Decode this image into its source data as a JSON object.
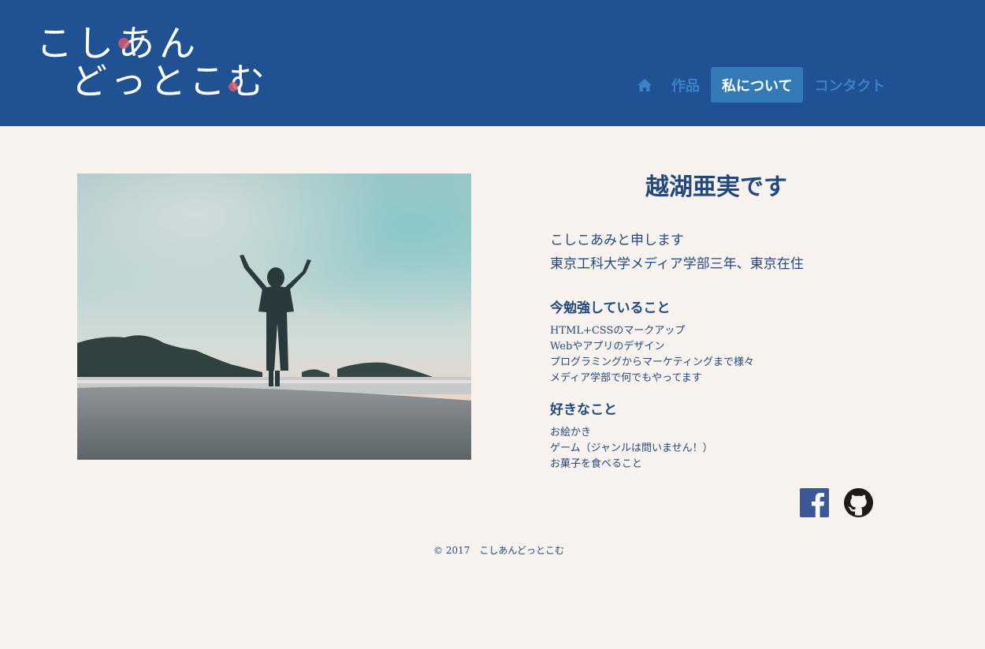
{
  "logo": {
    "line1": "こしあん",
    "line2": "どっとこむ"
  },
  "nav": {
    "home_icon": "home-icon",
    "items": [
      {
        "label": "作品",
        "active": false
      },
      {
        "label": "私について",
        "active": true
      },
      {
        "label": "コンタクト",
        "active": false
      }
    ]
  },
  "colors": {
    "header_bg": "#205293",
    "page_bg": "#f8f3ee",
    "text": "#22497f",
    "nav_link": "#3a82c8",
    "nav_active_bg": "#337ab7",
    "facebook": "#3b5998",
    "github": "#1b1b1b"
  },
  "profile": {
    "photo_icon": "silhouette-photo",
    "title": "越湖亜実です",
    "intro_line1": "こしこあみと申します",
    "intro_line2": "東京工科大学メディア学部三年、東京在住",
    "study_heading": "今勉強していること",
    "study_items": [
      "HTML+CSSのマークアップ",
      "Webやアプリのデザイン",
      "プログラミングからマーケティングまで様々",
      "メディア学部で何でもやってます"
    ],
    "like_heading": "好きなこと",
    "like_items": [
      "お絵かき",
      "ゲーム（ジャンルは問いません！）",
      "お菓子を食べること"
    ]
  },
  "social": {
    "facebook_icon": "facebook-icon",
    "github_icon": "github-icon"
  },
  "footer": {
    "copyright": "© 2017　こしあんどっとこむ"
  }
}
